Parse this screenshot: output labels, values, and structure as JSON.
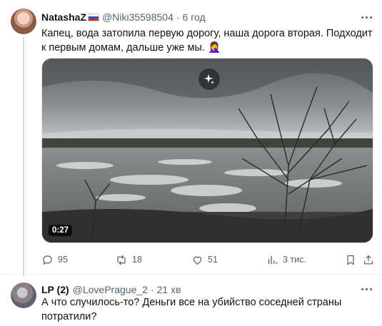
{
  "tweet1": {
    "author_name": "NatashaZ",
    "handle": "@Niki35598504",
    "separator": "·",
    "time": "6 год",
    "text": "Капец, вода затопила первую дорогу, наша дорога вторая. Подходит к первым домам, дальше уже мы. 🤦‍♀️",
    "video_duration": "0:27",
    "stats": {
      "replies": "95",
      "retweets": "18",
      "likes": "51",
      "views": "3 тис."
    }
  },
  "tweet2": {
    "author_name": "LP (2)",
    "handle": "@LovePrague_2",
    "separator": "·",
    "time": "21 хв",
    "text": "А что случилось-то? Деньги все на убийство соседней страны потратили?"
  },
  "icons": {
    "flag": "russia-flag-icon",
    "more": "more-dots-icon",
    "sparkle": "grok-sparkle-icon",
    "reply": "reply-icon",
    "retweet": "retweet-icon",
    "like": "heart-icon",
    "views": "views-chart-icon",
    "bookmark": "bookmark-icon",
    "share": "share-icon"
  },
  "colors": {
    "text": "#0f1419",
    "secondary": "#536471",
    "divider": "#eff3f4"
  }
}
